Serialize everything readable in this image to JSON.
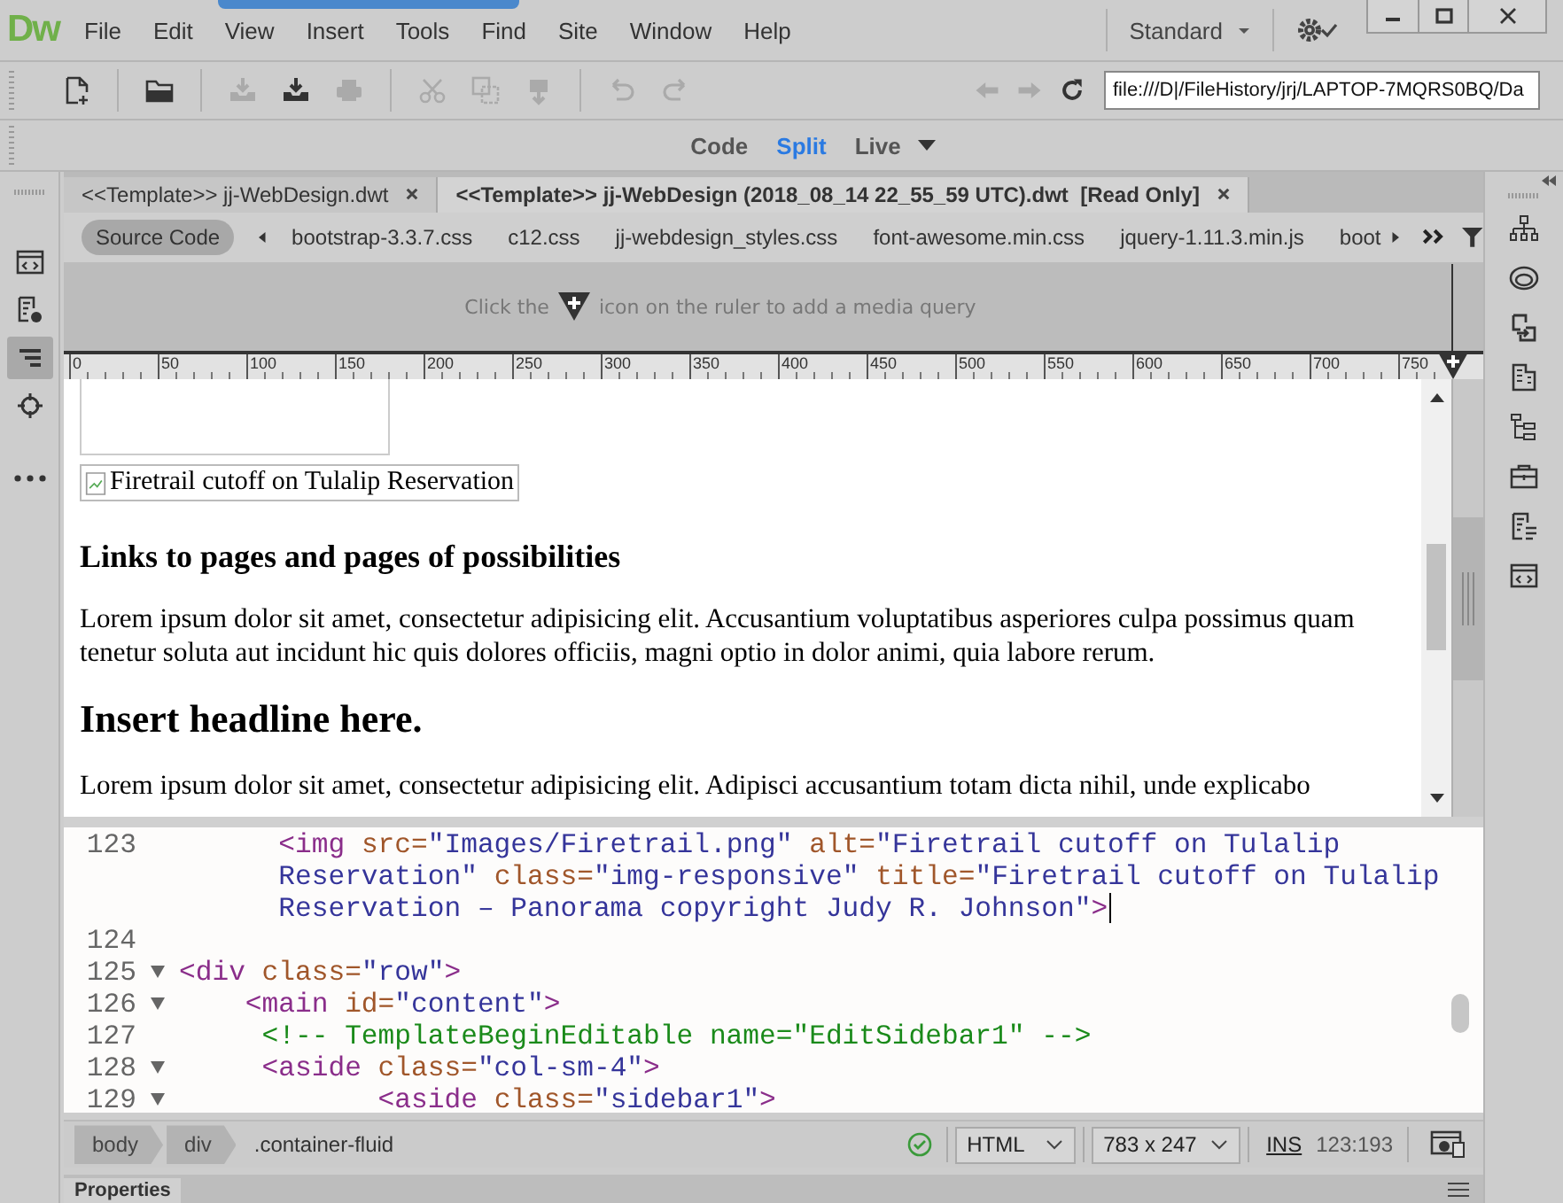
{
  "app": {
    "logo": "Dw",
    "menu": [
      "File",
      "Edit",
      "View",
      "Insert",
      "Tools",
      "Find",
      "Site",
      "Window",
      "Help"
    ],
    "workspace": "Standard"
  },
  "toolbar": [
    {
      "kind": "new",
      "disabled": false
    },
    {
      "kind": "open",
      "disabled": false
    },
    {
      "kind": "get",
      "disabled": true
    },
    {
      "kind": "put",
      "disabled": false
    },
    {
      "kind": "print",
      "disabled": true
    },
    {
      "kind": "cut",
      "disabled": true
    },
    {
      "kind": "copy",
      "disabled": true
    },
    {
      "kind": "paste",
      "disabled": true
    },
    {
      "kind": "undo",
      "disabled": true
    },
    {
      "kind": "redo",
      "disabled": true
    }
  ],
  "navigation": [
    {
      "kind": "back",
      "disabled": true
    },
    {
      "kind": "forward",
      "disabled": true
    },
    {
      "kind": "refresh",
      "disabled": false
    }
  ],
  "address": "file:///D|/FileHistory/jrj/LAPTOP-7MQRS0BQ/Da",
  "views": [
    {
      "label": "Code",
      "selected": false
    },
    {
      "label": "Split",
      "selected": true
    },
    {
      "label": "Live",
      "selected": false
    }
  ],
  "left_tools": [
    {
      "kind": "code",
      "selected": false
    },
    {
      "kind": "inspect",
      "selected": false
    },
    {
      "kind": "structure",
      "selected": true
    },
    {
      "kind": "target",
      "selected": false
    },
    {
      "kind": "more",
      "selected": false
    }
  ],
  "right_tools": [
    {
      "kind": "sitemap"
    },
    {
      "kind": "cloud"
    },
    {
      "kind": "export"
    },
    {
      "kind": "building"
    },
    {
      "kind": "tree"
    },
    {
      "kind": "briefcase"
    },
    {
      "kind": "document"
    },
    {
      "kind": "code"
    }
  ],
  "doc_tabs": [
    {
      "label": "<<Template>> jj-WebDesign.dwt",
      "selected": false
    },
    {
      "label": "<<Template>> jj-WebDesign (2018_08_14 22_55_59 UTC).dwt  [Read Only]",
      "selected": true
    }
  ],
  "related_files": [
    {
      "label": "Source Code",
      "selected": true
    },
    {
      "label": "bootstrap-3.3.7.css",
      "selected": false
    },
    {
      "label": "c12.css",
      "selected": false
    },
    {
      "label": "jj-webdesign_styles.css",
      "selected": false
    },
    {
      "label": "font-awesome.min.css",
      "selected": false
    },
    {
      "label": "jquery-1.11.3.min.js",
      "selected": false
    },
    {
      "label": "boot",
      "selected": false
    }
  ],
  "media_hint": {
    "before": "Click the",
    "after": "icon on the ruler to add a media query"
  },
  "ruler": [
    "0",
    "50",
    "100",
    "150",
    "200",
    "250",
    "300",
    "350",
    "400",
    "450",
    "500",
    "550",
    "600",
    "650",
    "700",
    "750"
  ],
  "design": {
    "image_alt": "Firetrail cutoff on Tulalip Reservation",
    "heading": "Links to pages and pages of possibilities",
    "paragraph": "Lorem ipsum dolor sit amet, consectetur adipisicing elit. Accusantium voluptatibus asperiores culpa possimus quam tenetur soluta aut incidunt hic quis dolores officiis, magni optio in dolor animi, quia labore rerum.",
    "headline": "Insert headline here.",
    "paragraph_2": "Lorem ipsum dolor sit amet, consectetur adipisicing elit. Adipisci accusantium totam dicta nihil, unde explicabo"
  },
  "code": [
    {
      "number": "123",
      "fold": false,
      "rows": [
        {
          "segments": [
            {
              "kind": "tag",
              "text": "      <img "
            },
            {
              "kind": "attr",
              "text": "src="
            },
            {
              "kind": "value",
              "text": "\"Images/Firetrail.png\" "
            },
            {
              "kind": "attr",
              "text": "alt="
            },
            {
              "kind": "value",
              "text": "\"Firetrail cutoff on Tulalip"
            }
          ]
        },
        {
          "segments": [
            {
              "kind": "value",
              "text": "      Reservation\" "
            },
            {
              "kind": "attr",
              "text": "class="
            },
            {
              "kind": "value",
              "text": "\"img-responsive\" "
            },
            {
              "kind": "attr",
              "text": "title="
            },
            {
              "kind": "value",
              "text": "\"Firetrail cutoff on Tulalip"
            }
          ]
        },
        {
          "segments": [
            {
              "kind": "value",
              "text": "      Reservation – Panorama copyright Judy R. Johnson\""
            },
            {
              "kind": "tag",
              "text": ">"
            }
          ]
        }
      ],
      "cursor": true
    },
    {
      "number": "124",
      "fold": false,
      "rows": [
        {
          "segments": []
        }
      ],
      "cursor": false
    },
    {
      "number": "125",
      "fold": true,
      "rows": [
        {
          "segments": [
            {
              "kind": "tag",
              "text": "<div "
            },
            {
              "kind": "attr",
              "text": "class="
            },
            {
              "kind": "value",
              "text": "\"row\""
            },
            {
              "kind": "tag",
              "text": ">"
            }
          ]
        }
      ],
      "cursor": false
    },
    {
      "number": "126",
      "fold": true,
      "rows": [
        {
          "segments": [
            {
              "kind": "tag",
              "text": "    <main "
            },
            {
              "kind": "attr",
              "text": "id="
            },
            {
              "kind": "value",
              "text": "\"content\""
            },
            {
              "kind": "tag",
              "text": ">"
            }
          ]
        }
      ],
      "cursor": false
    },
    {
      "number": "127",
      "fold": false,
      "rows": [
        {
          "segments": [
            {
              "kind": "comment",
              "text": "     <!-- TemplateBeginEditable name=\"EditSidebar1\" -->"
            }
          ]
        }
      ],
      "cursor": false
    },
    {
      "number": "128",
      "fold": true,
      "rows": [
        {
          "segments": [
            {
              "kind": "tag",
              "text": "     <aside "
            },
            {
              "kind": "attr",
              "text": "class="
            },
            {
              "kind": "value",
              "text": "\"col-sm-4\""
            },
            {
              "kind": "tag",
              "text": ">"
            }
          ]
        }
      ],
      "cursor": false
    },
    {
      "number": "129",
      "fold": true,
      "rows": [
        {
          "segments": [
            {
              "kind": "tag",
              "text": "            <aside "
            },
            {
              "kind": "attr",
              "text": "class="
            },
            {
              "kind": "value",
              "text": "\"sidebar1\""
            },
            {
              "kind": "tag",
              "text": ">"
            }
          ]
        }
      ],
      "cursor": false
    }
  ],
  "status": {
    "breadcrumbs": [
      "body",
      "div"
    ],
    "selector": ".container-fluid",
    "valid": true,
    "doc_type": "HTML",
    "size": "783 x 247",
    "mode": "INS",
    "position": "123:193"
  },
  "panel": {
    "title": "Properties"
  }
}
